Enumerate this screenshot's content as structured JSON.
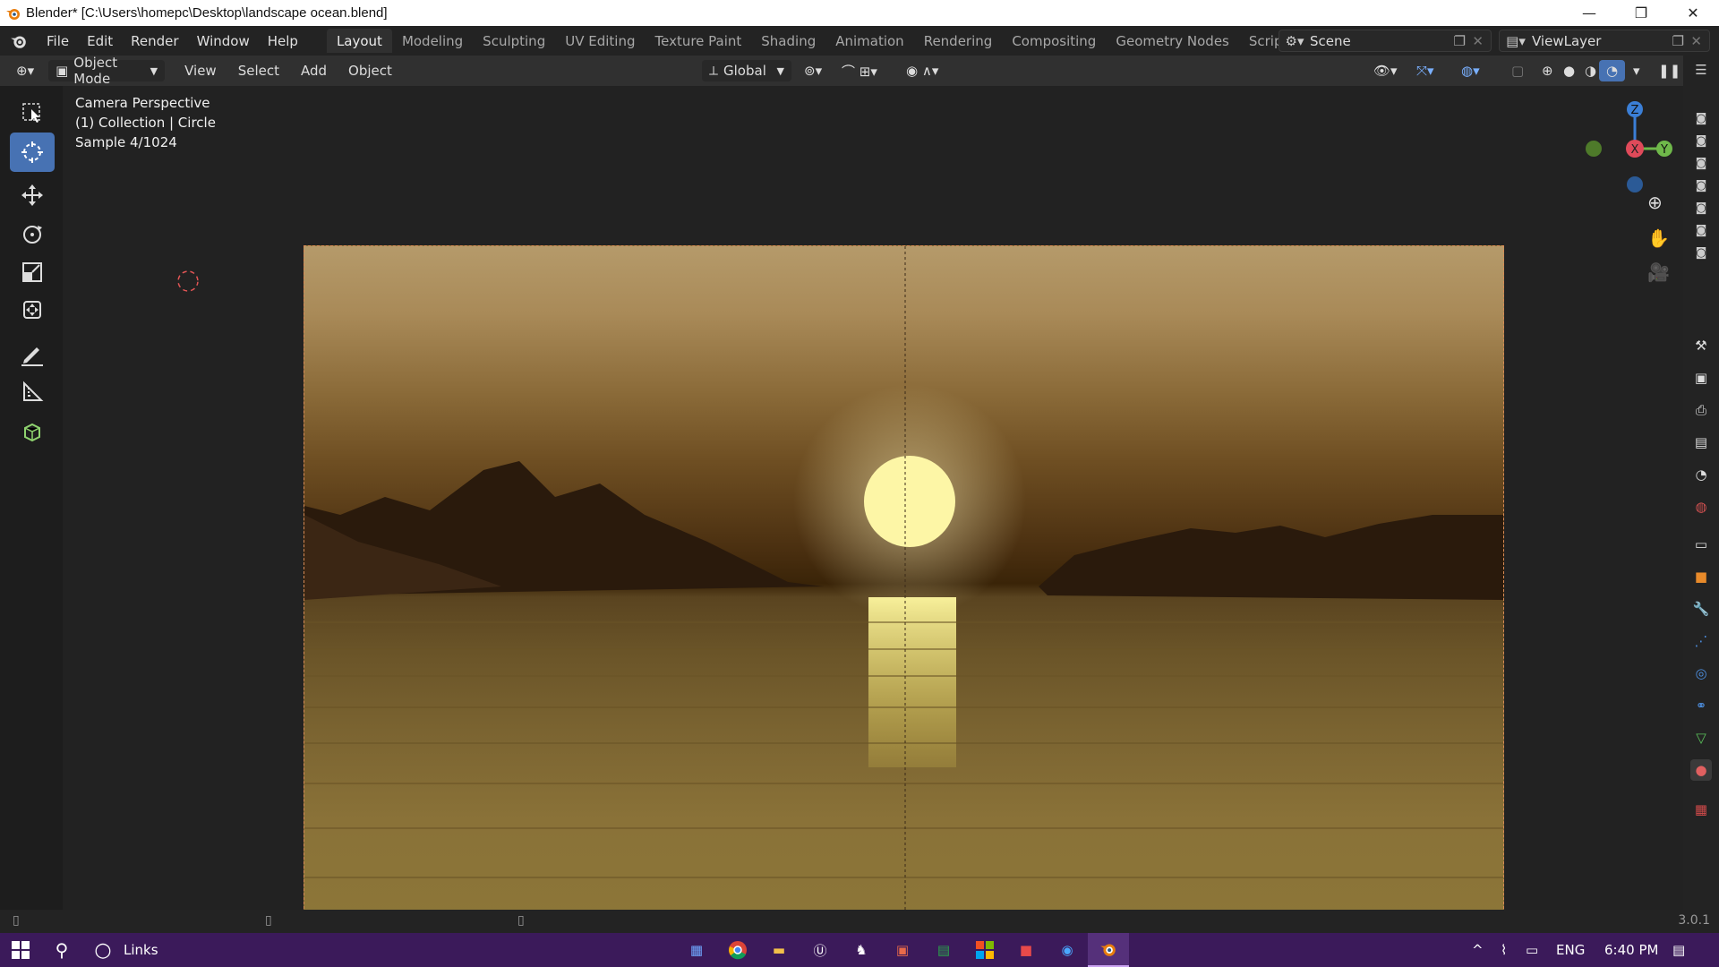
{
  "window": {
    "title": "Blender* [C:\\Users\\homepc\\Desktop\\landscape ocean.blend]",
    "min_label": "—",
    "restore_label": "❐",
    "close_label": "✕"
  },
  "menubar": {
    "items": [
      "File",
      "Edit",
      "Render",
      "Window",
      "Help"
    ],
    "workspaces": [
      "Layout",
      "Modeling",
      "Sculpting",
      "UV Editing",
      "Texture Paint",
      "Shading",
      "Animation",
      "Rendering",
      "Compositing",
      "Geometry Nodes",
      "Scripting"
    ],
    "add_tab": "+",
    "scene": "Scene",
    "view_layer": "ViewLayer"
  },
  "header": {
    "mode": "Object Mode",
    "menus": [
      "View",
      "Select",
      "Add",
      "Object"
    ],
    "orientation": "Global"
  },
  "viewport": {
    "line1": "Camera Perspective",
    "line2": "(1) Collection | Circle",
    "line3": "Sample 4/1024",
    "gizmo": {
      "z": "Z",
      "x": "X",
      "y": "Y"
    }
  },
  "statusbar": {
    "version": "3.0.1"
  },
  "taskbar": {
    "search_text": "Links",
    "lang": "ENG",
    "time": "6:40 PM"
  },
  "colors": {
    "accent": "#4772b3",
    "active_tool": "#4772b3",
    "taskbar": "#3b1a5a",
    "render_border": "#d88a55"
  }
}
